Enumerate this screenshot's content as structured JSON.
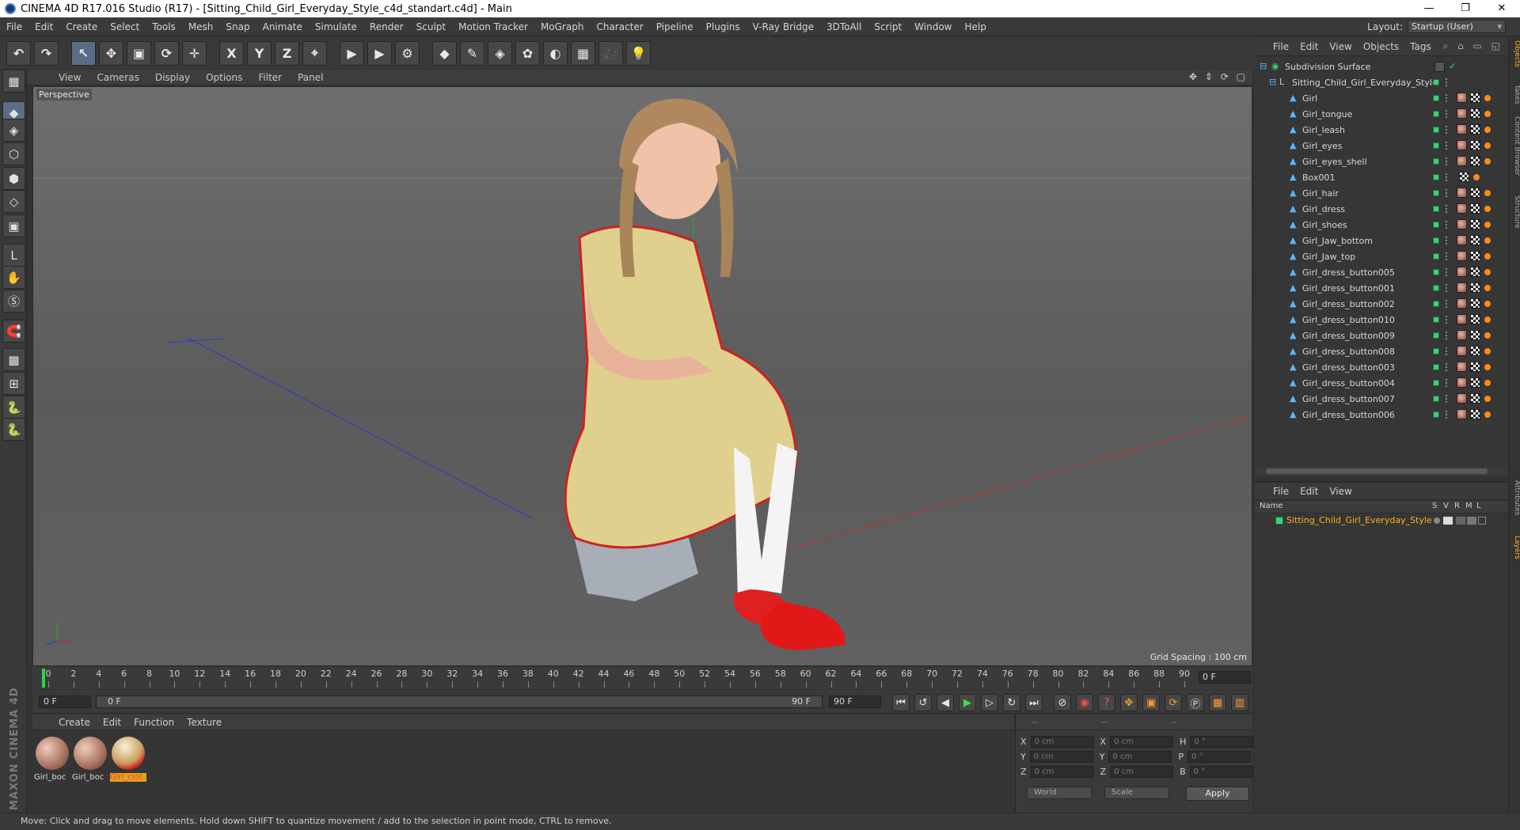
{
  "window": {
    "title": "CINEMA 4D R17.016 Studio (R17) - [Sitting_Child_Girl_Everyday_Style_c4d_standart.c4d] - Main",
    "buttons": [
      "—",
      "❐",
      "✕"
    ]
  },
  "menubar": {
    "items": [
      "File",
      "Edit",
      "Create",
      "Select",
      "Tools",
      "Mesh",
      "Snap",
      "Animate",
      "Simulate",
      "Render",
      "Sculpt",
      "Motion Tracker",
      "MoGraph",
      "Character",
      "Pipeline",
      "Plugins",
      "V-Ray Bridge",
      "3DToAll",
      "Script",
      "Window",
      "Help"
    ],
    "layout_label": "Layout:",
    "layout_value": "Startup (User)"
  },
  "toolbar": {
    "buttons": [
      {
        "name": "undo-icon",
        "glyph": "↶"
      },
      {
        "name": "redo-icon",
        "glyph": "↷"
      },
      {
        "name": "select-tool-icon",
        "glyph": "↖"
      },
      {
        "name": "move-tool-icon",
        "glyph": "✥"
      },
      {
        "name": "scale-tool-icon",
        "glyph": "▣"
      },
      {
        "name": "rotate-tool-icon",
        "glyph": "⟳"
      },
      {
        "name": "recent-tool-icon",
        "glyph": "✛"
      },
      {
        "name": "x-axis-lock-icon",
        "glyph": "X"
      },
      {
        "name": "y-axis-lock-icon",
        "glyph": "Y"
      },
      {
        "name": "z-axis-lock-icon",
        "glyph": "Z"
      },
      {
        "name": "coordinate-system-icon",
        "glyph": "⌖"
      },
      {
        "name": "render-view-icon",
        "glyph": "▶"
      },
      {
        "name": "render-picture-viewer-icon",
        "glyph": "▶"
      },
      {
        "name": "render-settings-icon",
        "glyph": "⚙"
      },
      {
        "name": "cube-icon",
        "glyph": "◆"
      },
      {
        "name": "pen-spline-icon",
        "glyph": "✎"
      },
      {
        "name": "subdivision-icon",
        "glyph": "◈"
      },
      {
        "name": "array-icon",
        "glyph": "✿"
      },
      {
        "name": "deformer-icon",
        "glyph": "◐"
      },
      {
        "name": "floor-icon",
        "glyph": "▦"
      },
      {
        "name": "camera-icon",
        "glyph": "🎥"
      },
      {
        "name": "light-icon",
        "glyph": "💡"
      }
    ]
  },
  "left_tools": [
    "make-editable-icon",
    "model-mode-icon",
    "texture-mode-icon",
    "workplane-icon",
    "points-mode-icon",
    "edges-mode-icon",
    "polygons-mode-icon",
    "axis-mode-icon",
    "tweak-mode-icon",
    "solo-mode-icon",
    "snap-icon",
    "workplane-lock-icon",
    "grid-snap-icon",
    "python-icon",
    "python-script-icon"
  ],
  "viewport": {
    "menu": [
      "View",
      "Cameras",
      "Display",
      "Options",
      "Filter",
      "Panel"
    ],
    "label": "Perspective",
    "grid_spacing": "Grid Spacing : 100 cm",
    "nav": "✥ ⇕ ⟳ ▢"
  },
  "timeline": {
    "ticks": [
      "0",
      "2",
      "4",
      "6",
      "8",
      "10",
      "12",
      "14",
      "16",
      "18",
      "20",
      "22",
      "24",
      "26",
      "28",
      "30",
      "32",
      "34",
      "36",
      "38",
      "40",
      "42",
      "44",
      "46",
      "48",
      "50",
      "52",
      "54",
      "56",
      "58",
      "60",
      "62",
      "64",
      "66",
      "68",
      "70",
      "72",
      "74",
      "76",
      "78",
      "80",
      "82",
      "84",
      "86",
      "88",
      "90"
    ],
    "current_frame": "0 F"
  },
  "transport": {
    "start_field": "0 F",
    "range_start": "0 F",
    "range_end": "90 F",
    "end_field": "90 F"
  },
  "materials": {
    "menu": [
      "Create",
      "Edit",
      "Function",
      "Texture"
    ],
    "items": [
      {
        "label": "Girl_boc",
        "selected": false
      },
      {
        "label": "Girl_boc",
        "selected": false
      },
      {
        "label": "Girl_clot",
        "selected": true
      }
    ]
  },
  "coordinates": {
    "header": [
      "--",
      "--",
      "--"
    ],
    "rows": [
      {
        "a": "X",
        "av": "0 cm",
        "b": "X",
        "bv": "0 cm",
        "c": "H",
        "cv": "0 °"
      },
      {
        "a": "Y",
        "av": "0 cm",
        "b": "Y",
        "bv": "0 cm",
        "c": "P",
        "cv": "0 °"
      },
      {
        "a": "Z",
        "av": "0 cm",
        "b": "Z",
        "bv": "0 cm",
        "c": "B",
        "cv": "0 °"
      }
    ],
    "mode": "World",
    "scale": "Scale",
    "apply": "Apply"
  },
  "branding": "MAXON CINEMA 4D",
  "status": "Move: Click and drag to move elements. Hold down SHIFT to quantize movement / add to the selection in point mode, CTRL to remove.",
  "objects": {
    "menu": [
      "File",
      "Edit",
      "View",
      "Objects",
      "Tags"
    ],
    "root": "Subdivision Surface",
    "group": "Sitting_Child_Girl_Everyday_Style",
    "children": [
      "Girl",
      "Girl_tongue",
      "Girl_leash",
      "Girl_eyes",
      "Girl_eyes_shell",
      "Box001",
      "Girl_hair",
      "Girl_dress",
      "Girl_shoes",
      "Girl_Jaw_bottom",
      "Girl_Jaw_top",
      "Girl_dress_button005",
      "Girl_dress_button001",
      "Girl_dress_button002",
      "Girl_dress_button010",
      "Girl_dress_button009",
      "Girl_dress_button008",
      "Girl_dress_button003",
      "Girl_dress_button004",
      "Girl_dress_button007",
      "Girl_dress_button006"
    ]
  },
  "layers": {
    "menu": [
      "File",
      "Edit",
      "View"
    ],
    "header_name": "Name",
    "header_cols": [
      "S",
      "V",
      "R",
      "M",
      "L"
    ],
    "row": "Sitting_Child_Girl_Everyday_Style"
  },
  "sidetabs": [
    "Objects",
    "Takes",
    "Content Browser",
    "Structure",
    "Attributes",
    "Layers"
  ]
}
